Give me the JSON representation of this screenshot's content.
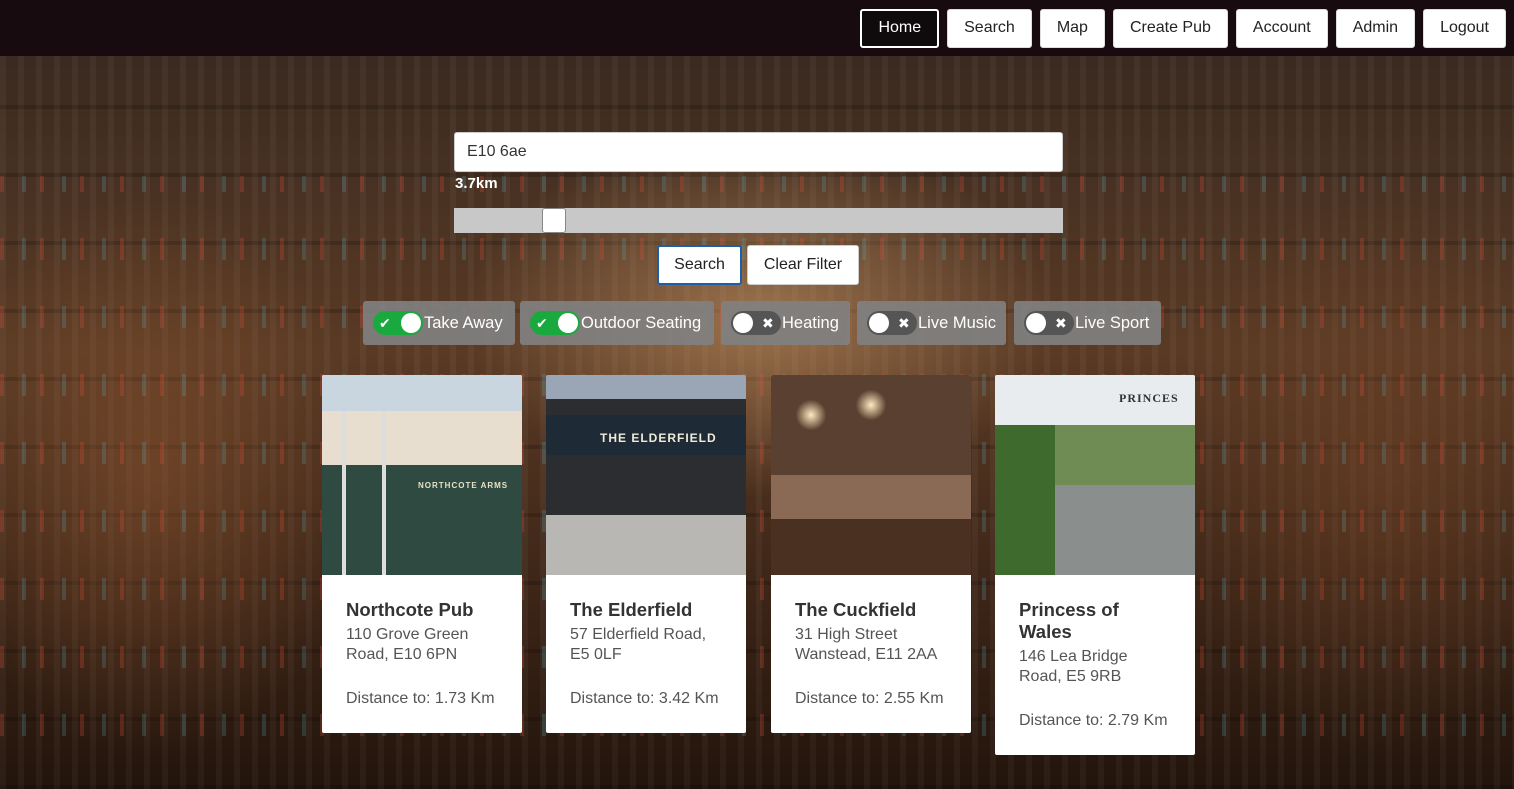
{
  "nav": {
    "items": [
      "Home",
      "Search",
      "Map",
      "Create Pub",
      "Account",
      "Admin",
      "Logout"
    ],
    "active": "Home"
  },
  "search": {
    "value": "E10 6ae",
    "radius_label": "3.7km",
    "radius_fraction": 0.15,
    "search_button": "Search",
    "clear_button": "Clear Filter"
  },
  "filters": [
    {
      "label": "Take Away",
      "on": true
    },
    {
      "label": "Outdoor Seating",
      "on": true
    },
    {
      "label": "Heating",
      "on": false
    },
    {
      "label": "Live Music",
      "on": false
    },
    {
      "label": "Live Sport",
      "on": false
    }
  ],
  "pubs": [
    {
      "name": "Northcote Pub",
      "address": "110 Grove Green Road, E10 6PN",
      "distance": "Distance to: 1.73 Km",
      "sign": "NORTHCOTE ARMS"
    },
    {
      "name": "The Elderfield",
      "address": "57 Elderfield Road, E5 0LF",
      "distance": "Distance to: 3.42 Km",
      "sign": "THE ELDERFIELD"
    },
    {
      "name": "The Cuckfield",
      "address": "31 High Street Wanstead, E11 2AA",
      "distance": "Distance to: 2.55 Km",
      "sign": ""
    },
    {
      "name": "Princess of Wales",
      "address": "146 Lea Bridge Road, E5 9RB",
      "distance": "Distance to: 2.79 Km",
      "sign": "PRINCES"
    }
  ],
  "colors": {
    "navbar": "#170b0f",
    "toggle_on": "#1aa93e",
    "toggle_off": "#555555",
    "search_border": "#1a5fa8"
  },
  "icons": {
    "toggle_on_mark": "check-icon",
    "toggle_off_mark": "cross-icon"
  }
}
